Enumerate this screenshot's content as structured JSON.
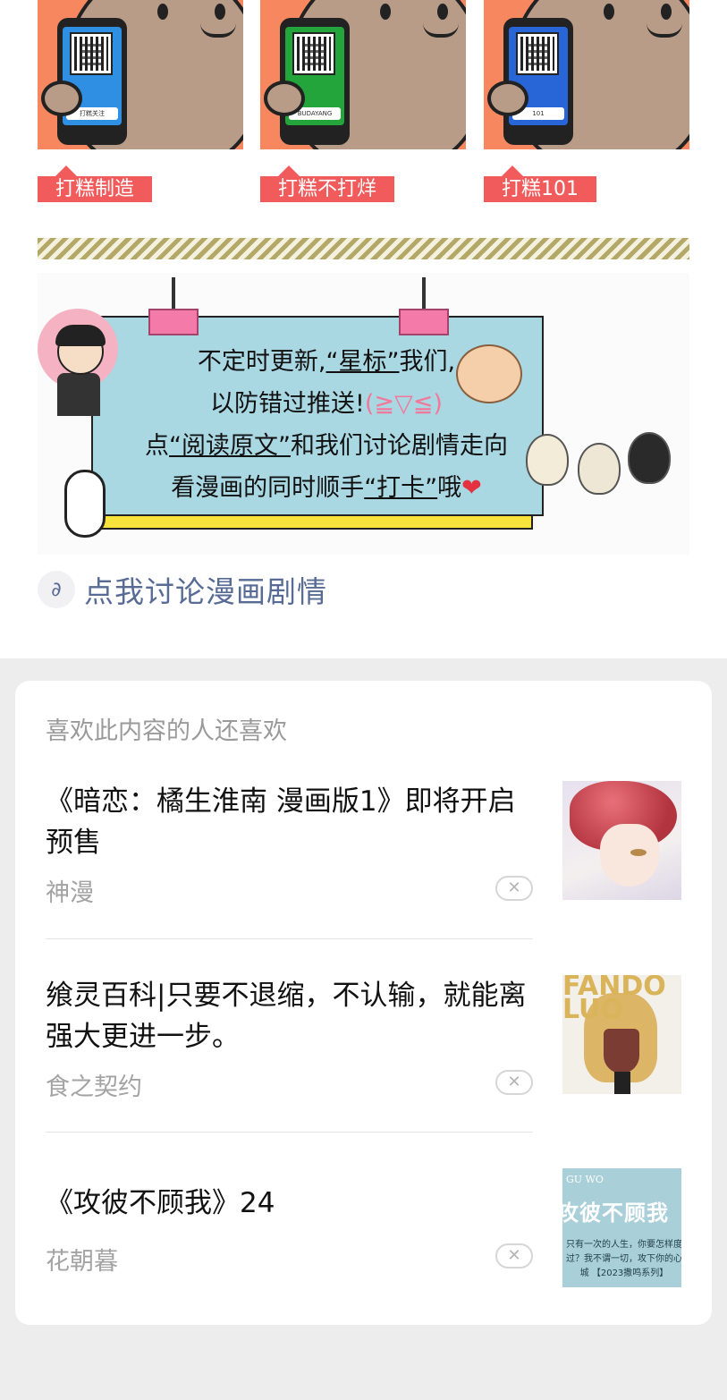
{
  "top_tips": [
    {
      "tag": "打糕制造",
      "phone_color": "#2f8fe3",
      "brand": "打糕关注"
    },
    {
      "tag": "打糕不打烊",
      "phone_color": "#23a53c",
      "brand": "BUDAYANG"
    },
    {
      "tag": "打糕101",
      "phone_color": "#2866d8",
      "brand": "101"
    }
  ],
  "banner": {
    "line1_a": "不定时更新,",
    "line1_hl": "“星标”",
    "line1_b": "我们,",
    "line2_a": "以防错过推送!",
    "line2_emote": "(≧▽≦)",
    "line3_a": "点",
    "line3_hl": "“阅读原文”",
    "line3_b": "和我们讨论剧情走向",
    "line4_a": "看漫画的同时顺手",
    "line4_hl": "“打卡”",
    "line4_b": "哦",
    "line4_heart": "❤"
  },
  "mini_program": {
    "icon": "link-icon",
    "icon_glyph": "∂",
    "label": "点我讨论漫画剧情"
  },
  "recommendations": {
    "heading": "喜欢此内容的人还喜欢",
    "dismiss_glyph": "✕",
    "items": [
      {
        "title": "《暗恋：橘生淮南 漫画版1》即将开启预售",
        "source": "神漫"
      },
      {
        "title": "飨灵百科|只要不退缩，不认输，就能离强大更进一步。",
        "source": "食之契约",
        "thumb_text": "FANDO LUO"
      },
      {
        "title": "《攻彼不顾我》24",
        "source": "花朝暮",
        "thumb_tag": "GU WO",
        "thumb_title": "攻彼不顾我",
        "thumb_sub": "只有一次的人生，你要怎样度过？我不谓一切，攻下你的心城 【2023撒鸣系列】"
      }
    ]
  }
}
